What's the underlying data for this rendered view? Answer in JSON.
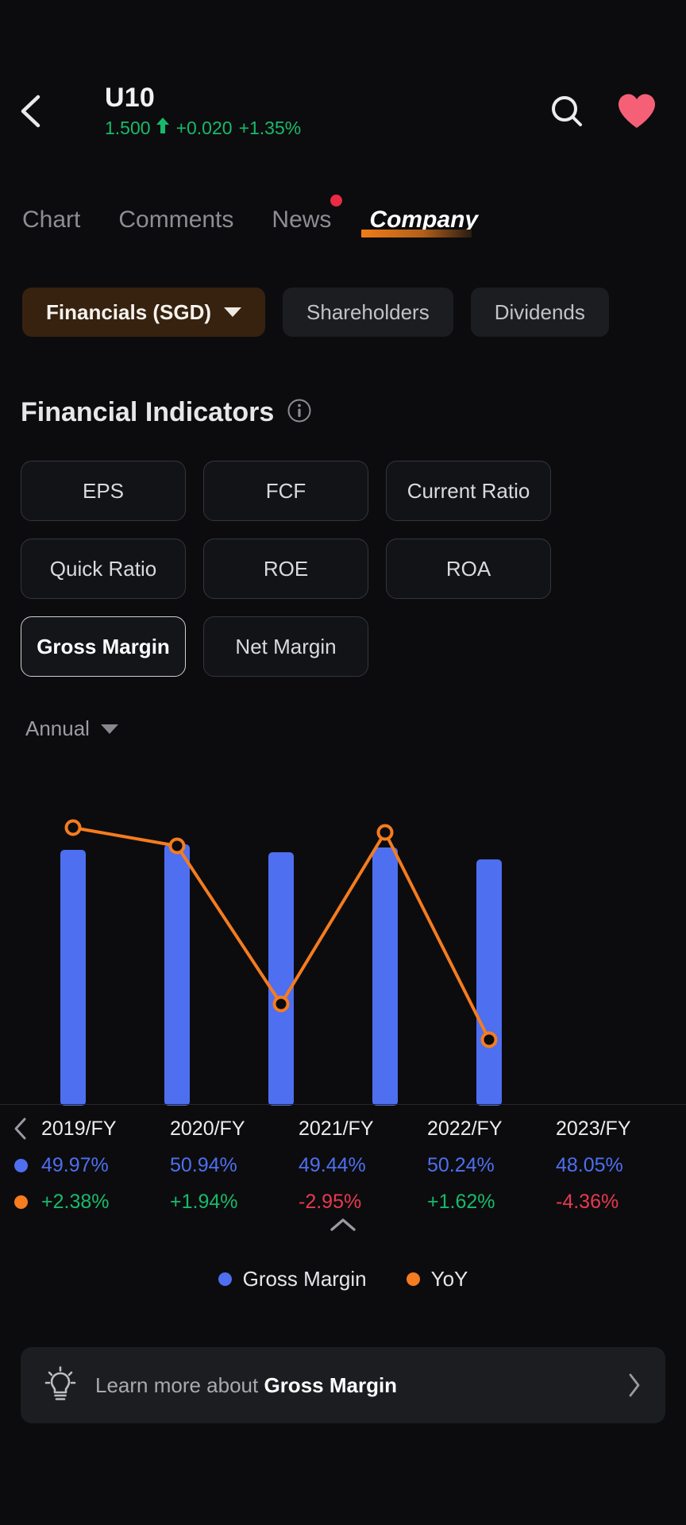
{
  "header": {
    "back_icon": "chevron-left-icon",
    "ticker": "U10",
    "price": "1.500",
    "arrow": "↑",
    "change": "+0.020",
    "change_pct": "+1.35%",
    "search_icon": "search-icon",
    "favorite_icon": "heart-icon",
    "accent_up": "#18b96b",
    "heart_color": "#f56077"
  },
  "tabs": [
    {
      "label": "Chart",
      "active": false,
      "badge": false
    },
    {
      "label": "Comments",
      "active": false,
      "badge": false
    },
    {
      "label": "News",
      "active": false,
      "badge": true
    },
    {
      "label": "Company",
      "active": true,
      "badge": false
    }
  ],
  "pills": [
    {
      "label": "Financials (SGD)",
      "active": true,
      "caret": true
    },
    {
      "label": "Shareholders",
      "active": false,
      "caret": false
    },
    {
      "label": "Dividends",
      "active": false,
      "caret": false
    }
  ],
  "section": {
    "title": "Financial Indicators",
    "info_icon": "info-icon"
  },
  "indicators": [
    {
      "label": "EPS",
      "selected": false
    },
    {
      "label": "FCF",
      "selected": false
    },
    {
      "label": "Current Ratio",
      "selected": false
    },
    {
      "label": "Quick Ratio",
      "selected": false
    },
    {
      "label": "ROE",
      "selected": false
    },
    {
      "label": "ROA",
      "selected": false
    },
    {
      "label": "Gross Margin",
      "selected": true
    },
    {
      "label": "Net Margin",
      "selected": false
    }
  ],
  "period": {
    "label": "Annual",
    "caret_icon": "chevron-down-icon"
  },
  "chart_data": {
    "type": "bar",
    "title": "Gross Margin",
    "categories": [
      "2019/FY",
      "2020/FY",
      "2021/FY",
      "2022/FY",
      "2023/FY"
    ],
    "series": [
      {
        "name": "Gross Margin",
        "color": "#4d6ff0",
        "type": "bar",
        "values": [
          49.97,
          50.94,
          49.44,
          50.24,
          48.05
        ],
        "labels": [
          "49.97%",
          "50.94%",
          "49.44%",
          "50.24%",
          "48.05%"
        ]
      },
      {
        "name": "YoY",
        "color": "#f57c1f",
        "type": "line",
        "values": [
          2.38,
          1.94,
          -2.95,
          1.62,
          -4.36
        ],
        "labels": [
          "+2.38%",
          "+1.94%",
          "-2.95%",
          "+1.62%",
          "-4.36%"
        ]
      }
    ],
    "xlabel": "",
    "ylabel": "",
    "grid": false,
    "legend": "bottom"
  },
  "table": {
    "prev_icon": "chevron-left-icon",
    "gross_margin_dot": "#4d6ff0",
    "yoy_dot": "#f57c1f",
    "years": [
      "2019/FY",
      "2020/FY",
      "2021/FY",
      "2022/FY",
      "2023/FY"
    ],
    "gross_margin": [
      "49.97%",
      "50.94%",
      "49.44%",
      "50.24%",
      "48.05%"
    ],
    "yoy": [
      "+2.38%",
      "+1.94%",
      "-2.95%",
      "+1.62%",
      "-4.36%"
    ],
    "yoy_sign": [
      "pos",
      "pos",
      "neg",
      "pos",
      "neg"
    ],
    "collapse_icon": "chevron-up-icon"
  },
  "legend": [
    {
      "label": "Gross Margin",
      "color": "#4d6ff0"
    },
    {
      "label": "YoY",
      "color": "#f57c1f"
    }
  ],
  "learn_more": {
    "bulb_icon": "lightbulb-icon",
    "prefix": "Learn more about ",
    "term": "Gross Margin",
    "chevron_icon": "chevron-right-icon"
  },
  "colors": {
    "background": "#0c0c0e",
    "bar": "#4d6ff0",
    "line": "#f57c1f",
    "positive": "#18b96b",
    "negative": "#e8394f",
    "accent": "#f07c18"
  }
}
